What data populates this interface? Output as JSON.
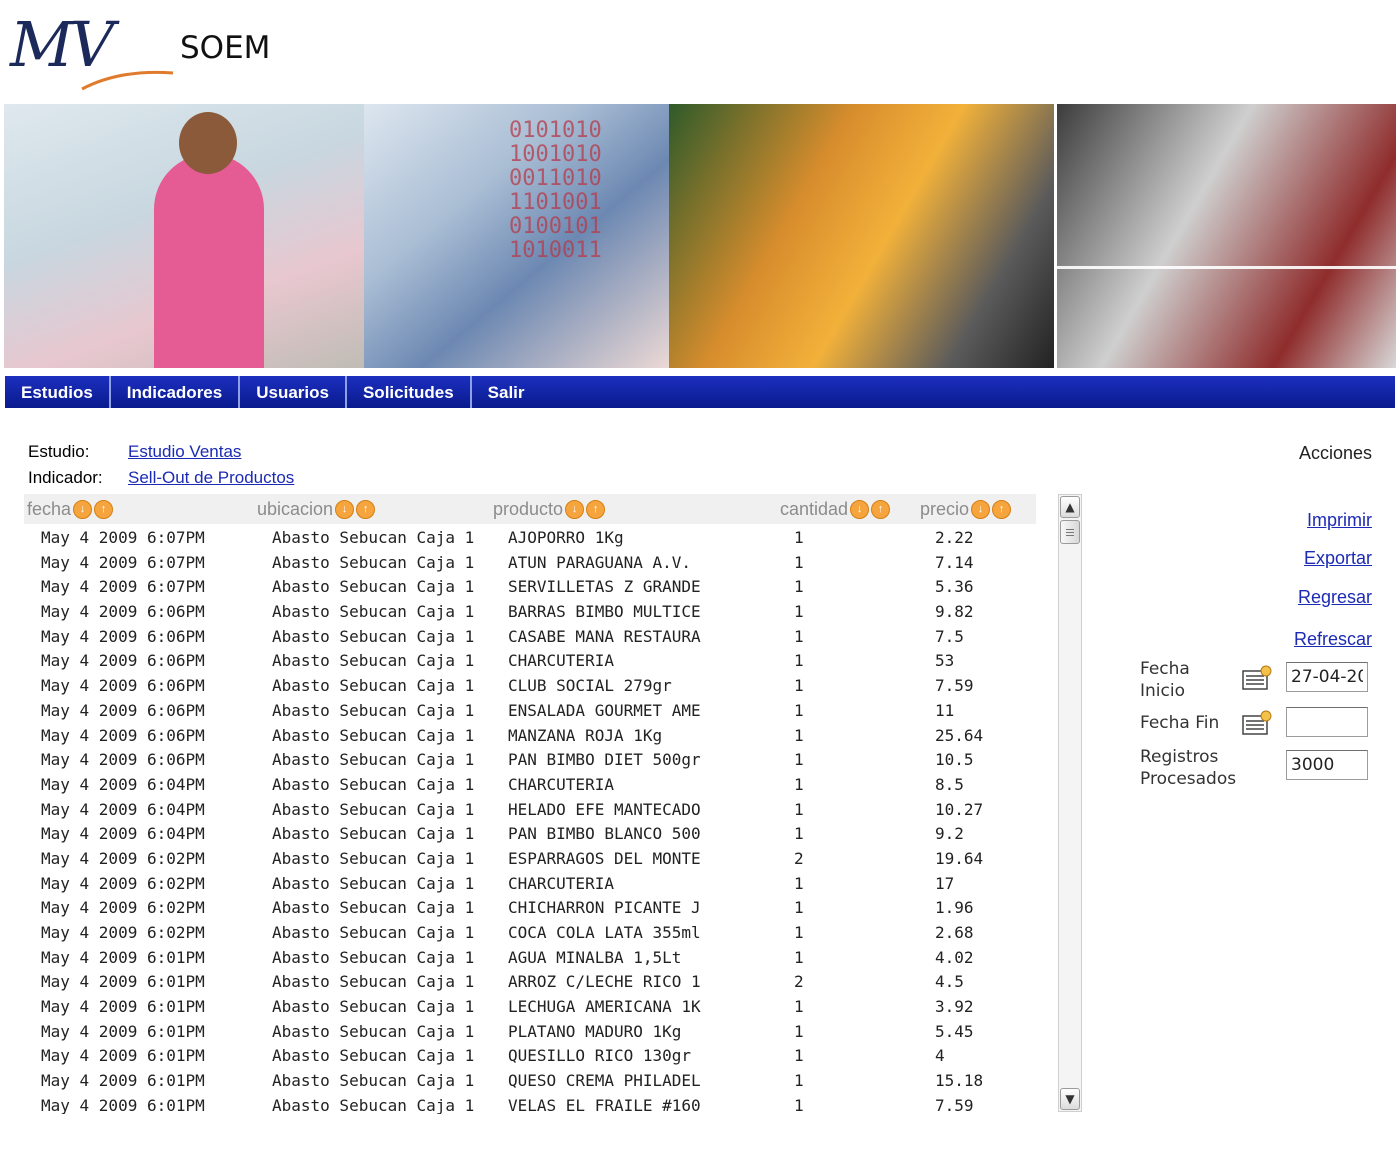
{
  "app": {
    "logo_text": "MV",
    "name": "SOEM"
  },
  "nav": {
    "items": [
      "Estudios",
      "Indicadores",
      "Usuarios",
      "Solicitudes",
      "Salir"
    ]
  },
  "info": {
    "estudio_label": "Estudio:",
    "estudio_value": "Estudio Ventas",
    "indicador_label": "Indicador:",
    "indicador_value": "Sell-Out de Productos"
  },
  "table": {
    "columns": [
      "fecha",
      "ubicacion",
      "producto",
      "cantidad",
      "precio"
    ],
    "rows": [
      [
        "May 4 2009 6:07PM",
        "Abasto Sebucan Caja 1",
        "AJOPORRO 1Kg",
        "1",
        "2.22"
      ],
      [
        "May 4 2009 6:07PM",
        "Abasto Sebucan Caja 1",
        "ATUN PARAGUANA A.V.",
        "1",
        "7.14"
      ],
      [
        "May 4 2009 6:07PM",
        "Abasto Sebucan Caja 1",
        "SERVILLETAS Z GRANDE",
        "1",
        "5.36"
      ],
      [
        "May 4 2009 6:06PM",
        "Abasto Sebucan Caja 1",
        "BARRAS BIMBO MULTICE",
        "1",
        "9.82"
      ],
      [
        "May 4 2009 6:06PM",
        "Abasto Sebucan Caja 1",
        "CASABE MANA RESTAURA",
        "1",
        "7.5"
      ],
      [
        "May 4 2009 6:06PM",
        "Abasto Sebucan Caja 1",
        "CHARCUTERIA",
        "1",
        "53"
      ],
      [
        "May 4 2009 6:06PM",
        "Abasto Sebucan Caja 1",
        "CLUB SOCIAL 279gr",
        "1",
        "7.59"
      ],
      [
        "May 4 2009 6:06PM",
        "Abasto Sebucan Caja 1",
        "ENSALADA GOURMET AME",
        "1",
        "11"
      ],
      [
        "May 4 2009 6:06PM",
        "Abasto Sebucan Caja 1",
        "MANZANA ROJA 1Kg",
        "1",
        "25.64"
      ],
      [
        "May 4 2009 6:06PM",
        "Abasto Sebucan Caja 1",
        "PAN BIMBO DIET 500gr",
        "1",
        "10.5"
      ],
      [
        "May 4 2009 6:04PM",
        "Abasto Sebucan Caja 1",
        "CHARCUTERIA",
        "1",
        "8.5"
      ],
      [
        "May 4 2009 6:04PM",
        "Abasto Sebucan Caja 1",
        "HELADO EFE MANTECADO",
        "1",
        "10.27"
      ],
      [
        "May 4 2009 6:04PM",
        "Abasto Sebucan Caja 1",
        "PAN BIMBO BLANCO 500",
        "1",
        "9.2"
      ],
      [
        "May 4 2009 6:02PM",
        "Abasto Sebucan Caja 1",
        "ESPARRAGOS DEL MONTE",
        "2",
        "19.64"
      ],
      [
        "May 4 2009 6:02PM",
        "Abasto Sebucan Caja 1",
        "CHARCUTERIA",
        "1",
        "17"
      ],
      [
        "May 4 2009 6:02PM",
        "Abasto Sebucan Caja 1",
        "CHICHARRON PICANTE J",
        "1",
        "1.96"
      ],
      [
        "May 4 2009 6:02PM",
        "Abasto Sebucan Caja 1",
        "COCA COLA LATA 355ml",
        "1",
        "2.68"
      ],
      [
        "May 4 2009 6:01PM",
        "Abasto Sebucan Caja 1",
        "AGUA MINALBA 1,5Lt",
        "1",
        "4.02"
      ],
      [
        "May 4 2009 6:01PM",
        "Abasto Sebucan Caja 1",
        "ARROZ C/LECHE RICO 1",
        "2",
        "4.5"
      ],
      [
        "May 4 2009 6:01PM",
        "Abasto Sebucan Caja 1",
        "LECHUGA AMERICANA 1K",
        "1",
        "3.92"
      ],
      [
        "May 4 2009 6:01PM",
        "Abasto Sebucan Caja 1",
        "PLATANO MADURO 1Kg",
        "1",
        "5.45"
      ],
      [
        "May 4 2009 6:01PM",
        "Abasto Sebucan Caja 1",
        "QUESILLO RICO 130gr",
        "1",
        "4"
      ],
      [
        "May 4 2009 6:01PM",
        "Abasto Sebucan Caja 1",
        "QUESO CREMA PHILADEL",
        "1",
        "15.18"
      ],
      [
        "May 4 2009 6:01PM",
        "Abasto Sebucan Caja 1",
        "VELAS EL FRAILE #160",
        "1",
        "7.59"
      ]
    ]
  },
  "actions": {
    "title": "Acciones",
    "links": [
      "Imprimir",
      "Exportar",
      "Regresar",
      "Refrescar"
    ]
  },
  "filters": {
    "fecha_inicio_label": "Fecha Inicio",
    "fecha_inicio_value": "27-04-20",
    "fecha_fin_label": "Fecha Fin",
    "fecha_fin_value": "",
    "registros_label": "Registros Procesados",
    "registros_value": "3000"
  },
  "colors": {
    "nav_bg": "#0a1a8e",
    "link": "#1c2ab4",
    "sort_icon": "#f6a43d"
  },
  "icons": {
    "sort": "sort-arrows-icon",
    "calendar": "calendar-icon",
    "scroll_up": "arrow-up-icon",
    "scroll_down": "arrow-down-icon"
  }
}
